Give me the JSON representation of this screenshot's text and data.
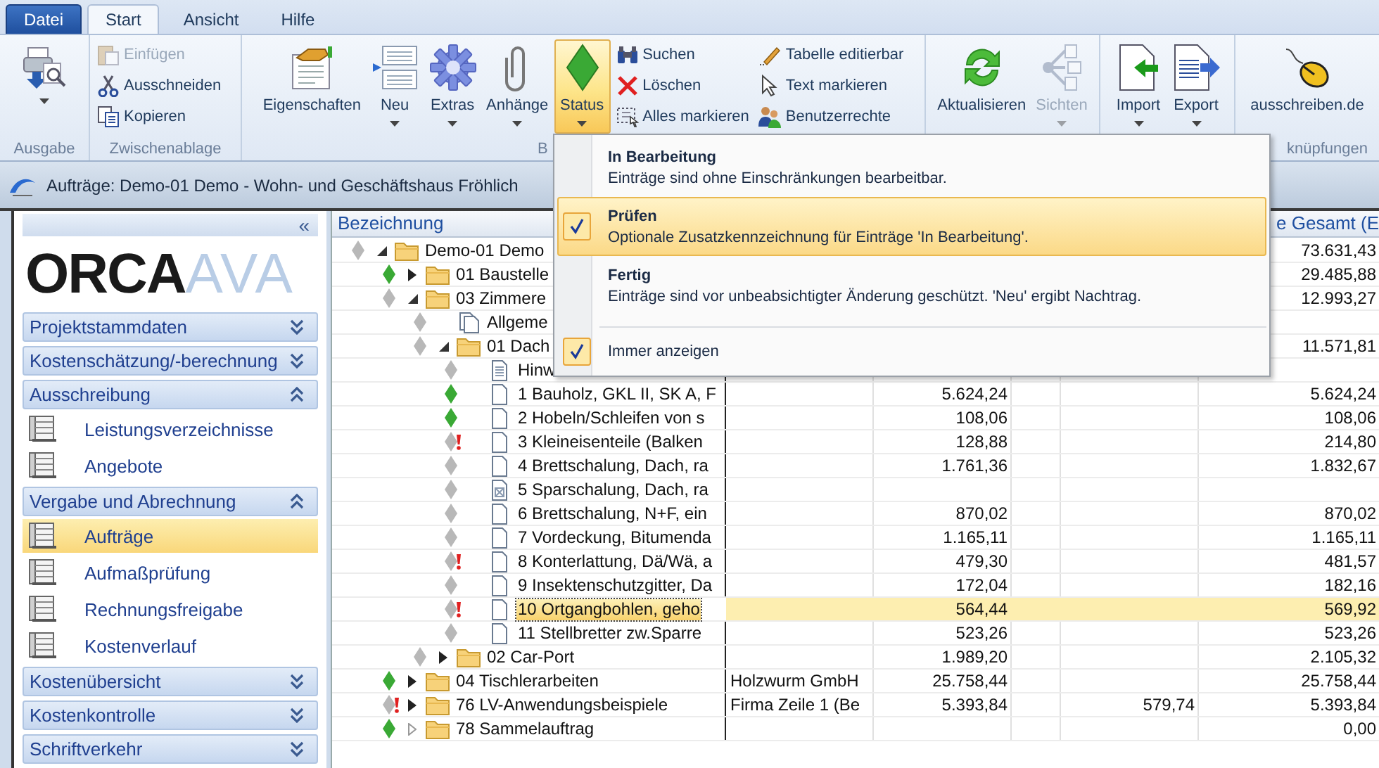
{
  "menu_tabs": [
    {
      "label": "Datei",
      "kind": "file",
      "selected": false
    },
    {
      "label": "Start",
      "kind": "tab",
      "selected": true
    },
    {
      "label": "Ansicht",
      "kind": "tab",
      "selected": false
    },
    {
      "label": "Hilfe",
      "kind": "tab",
      "selected": false
    }
  ],
  "ribbon_groups": [
    {
      "label": "Ausgabe",
      "items": [
        {
          "kind": "large",
          "has_menu": true,
          "disabled": false,
          "pressed": false
        }
      ]
    },
    {
      "label": "Zwischenablage",
      "items": [
        {
          "kind": "small",
          "label": "Einfügen",
          "disabled": true
        },
        {
          "kind": "small",
          "label": "Ausschneiden",
          "disabled": false
        },
        {
          "kind": "small",
          "label": "Kopieren",
          "disabled": false
        }
      ]
    },
    {
      "label": "B",
      "items": [
        {
          "kind": "large",
          "label": "Eigenschaften",
          "has_menu": false,
          "disabled": false,
          "pressed": false
        },
        {
          "kind": "large",
          "label": "Neu",
          "has_menu": true,
          "disabled": false,
          "pressed": false
        },
        {
          "kind": "large",
          "label": "Extras",
          "has_menu": true,
          "disabled": false,
          "pressed": false
        },
        {
          "kind": "large",
          "label": "Anhänge",
          "has_menu": true,
          "disabled": false,
          "pressed": false
        },
        {
          "kind": "large",
          "label": "Status",
          "has_menu": true,
          "disabled": false,
          "pressed": true
        },
        {
          "kind": "small",
          "label": "Suchen",
          "disabled": false
        },
        {
          "kind": "small",
          "label": "Löschen",
          "disabled": false
        },
        {
          "kind": "small",
          "label": "Alles markieren",
          "disabled": false
        },
        {
          "kind": "small",
          "label": "Tabelle editierbar",
          "disabled": false
        },
        {
          "kind": "small",
          "label": "Text markieren",
          "disabled": false
        },
        {
          "kind": "small",
          "label": "Benutzerrechte",
          "disabled": false
        }
      ]
    },
    {
      "items": [
        {
          "kind": "large",
          "label": "Aktualisieren",
          "has_menu": false,
          "disabled": false,
          "pressed": false
        },
        {
          "kind": "large",
          "label": "Sichten",
          "has_menu": true,
          "disabled": true,
          "pressed": false
        }
      ]
    },
    {
      "items": [
        {
          "kind": "large",
          "label": "Import",
          "has_menu": true,
          "disabled": false,
          "pressed": false
        },
        {
          "kind": "large",
          "label": "Export",
          "has_menu": true,
          "disabled": false,
          "pressed": false
        }
      ]
    },
    {
      "label": "knüpfungen",
      "items": [
        {
          "kind": "large",
          "label": "ausschreiben.de",
          "has_menu": false,
          "disabled": false,
          "pressed": false
        }
      ]
    }
  ],
  "document": {
    "title": "Aufträge: Demo-01 Demo - Wohn- und Geschäftshaus Fröhlich"
  },
  "sidebar": {
    "collapse_glyph": "«",
    "logo": {
      "part_1": "ORCA",
      "part_2": "AVA"
    },
    "sections": [
      {
        "label": "Projektstammdaten",
        "expanded": false
      },
      {
        "label": "Kostenschätzung/-berechnung",
        "expanded": false
      },
      {
        "label": "Ausschreibung",
        "expanded": true,
        "items": [
          {
            "label": "Leistungsverzeichnisse",
            "selected": false
          },
          {
            "label": "Angebote",
            "selected": false
          }
        ]
      },
      {
        "label": "Vergabe und Abrechnung",
        "expanded": true,
        "items": [
          {
            "label": "Aufträge",
            "selected": true
          },
          {
            "label": "Aufmaßprüfung",
            "selected": false
          },
          {
            "label": "Rechnungsfreigabe",
            "selected": false
          },
          {
            "label": "Kostenverlauf",
            "selected": false
          }
        ]
      },
      {
        "label": "Kostenübersicht",
        "expanded": false
      },
      {
        "label": "Kostenkontrolle",
        "expanded": false
      },
      {
        "label": "Schriftverkehr",
        "expanded": false
      }
    ]
  },
  "grid": {
    "header": {
      "column_1": "Bezeichnung",
      "column_6": "e Gesamt (E"
    },
    "rows": [
      {
        "label": "Demo-01 Demo",
        "kind": "folder",
        "expanded": true,
        "has_children": true,
        "color": "#b8b8b8",
        "warning": false,
        "selected": false,
        "cells": {
          "column_6": "73.631,43"
        },
        "children": [
          {
            "label": "01 Baustelle",
            "kind": "folder",
            "expanded": false,
            "has_children": true,
            "color": "#3aa935",
            "warning": false,
            "selected": false,
            "cells": {
              "column_6": "29.485,88"
            }
          },
          {
            "label": "03 Zimmere",
            "kind": "folder",
            "expanded": true,
            "has_children": true,
            "color": "#b8b8b8",
            "warning": false,
            "selected": false,
            "cells": {
              "column_6": "12.993,27"
            },
            "children": [
              {
                "label": "Allgeme",
                "kind": "multi-doc",
                "color": "#b8b8b8",
                "warning": false,
                "selected": false
              },
              {
                "label": "01 Dach",
                "kind": "folder",
                "expanded": true,
                "has_children": true,
                "color": "#b8b8b8",
                "warning": false,
                "selected": false,
                "cells": {
                  "column_6": "11.571,81"
                },
                "children": [
                  {
                    "label": "Hinw",
                    "kind": "text-doc",
                    "color": "#b8b8b8",
                    "warning": false,
                    "selected": false
                  },
                  {
                    "label": "1 Bauholz, GKL II, SK A, F",
                    "kind": "doc",
                    "color": "#3aa935",
                    "warning": false,
                    "selected": false,
                    "cells": {
                      "column_3": "5.624,24",
                      "column_6": "5.624,24"
                    }
                  },
                  {
                    "label": "2 Hobeln/Schleifen von s",
                    "kind": "doc",
                    "color": "#3aa935",
                    "warning": false,
                    "selected": false,
                    "cells": {
                      "column_3": "108,06",
                      "column_6": "108,06"
                    }
                  },
                  {
                    "label": "3 Kleineisenteile (Balken",
                    "kind": "doc",
                    "color": "#b8b8b8",
                    "warning": true,
                    "selected": false,
                    "cells": {
                      "column_3": "128,88",
                      "column_6": "214,80"
                    }
                  },
                  {
                    "label": "4 Brettschalung, Dach, ra",
                    "kind": "doc",
                    "color": "#b8b8b8",
                    "warning": false,
                    "selected": false,
                    "cells": {
                      "column_3": "1.761,36",
                      "column_6": "1.832,67"
                    }
                  },
                  {
                    "label": "5 Sparschalung, Dach, ra",
                    "kind": "void-doc",
                    "color": "#b8b8b8",
                    "warning": false,
                    "selected": false
                  },
                  {
                    "label": "6 Brettschalung, N+F, ein",
                    "kind": "doc",
                    "color": "#b8b8b8",
                    "warning": false,
                    "selected": false,
                    "cells": {
                      "column_3": "870,02",
                      "column_6": "870,02"
                    }
                  },
                  {
                    "label": "7 Vordeckung, Bitumenda",
                    "kind": "doc",
                    "color": "#b8b8b8",
                    "warning": false,
                    "selected": false,
                    "cells": {
                      "column_3": "1.165,11",
                      "column_6": "1.165,11"
                    }
                  },
                  {
                    "label": "8 Konterlattung, Dä/Wä, a",
                    "kind": "doc",
                    "color": "#b8b8b8",
                    "warning": true,
                    "selected": false,
                    "cells": {
                      "column_3": "479,30",
                      "column_6": "481,57"
                    }
                  },
                  {
                    "label": "9 Insektenschutzgitter, Da",
                    "kind": "doc",
                    "color": "#b8b8b8",
                    "warning": false,
                    "selected": false,
                    "cells": {
                      "column_3": "172,04",
                      "column_6": "182,16"
                    }
                  },
                  {
                    "label": "10 Ortgangbohlen, geho",
                    "kind": "doc",
                    "color": "#b8b8b8",
                    "warning": true,
                    "selected": true,
                    "cells": {
                      "column_3": "564,44",
                      "column_6": "569,92"
                    }
                  },
                  {
                    "label": "11 Stellbretter zw.Sparre",
                    "kind": "doc",
                    "color": "#b8b8b8",
                    "warning": false,
                    "selected": false,
                    "cells": {
                      "column_3": "523,26",
                      "column_6": "523,26"
                    }
                  }
                ]
              },
              {
                "label": "02 Car-Port",
                "kind": "folder",
                "expanded": false,
                "has_children": true,
                "color": "#b8b8b8",
                "warning": false,
                "selected": false,
                "cells": {
                  "column_3": "1.989,20",
                  "column_6": "2.105,32"
                }
              }
            ]
          },
          {
            "label": "04 Tischlerarbeiten",
            "kind": "folder",
            "expanded": false,
            "has_children": true,
            "color": "#3aa935",
            "warning": false,
            "selected": false,
            "cells": {
              "column_2": "Holzwurm GmbH",
              "column_3": "25.758,44",
              "column_6": "25.758,44"
            }
          },
          {
            "label": "76 LV-Anwendungsbeispiele",
            "kind": "folder",
            "expanded": false,
            "has_children": true,
            "color": "#b8b8b8",
            "warning": true,
            "selected": false,
            "cells": {
              "column_2": "Firma Zeile 1 (Be",
              "column_3": "5.393,84",
              "column_5": "579,74",
              "column_6": "5.393,84"
            }
          },
          {
            "label": "78 Sammelauftrag",
            "kind": "folder",
            "expanded": false,
            "has_children": false,
            "color": "#3aa935",
            "warning": false,
            "selected": false,
            "cells": {
              "column_6": "0,00"
            }
          }
        ]
      }
    ]
  },
  "status_menu": {
    "options": [
      {
        "title": "In Bearbeitung",
        "description": "Einträge sind ohne Einschränkungen bearbeitbar.",
        "checked": false,
        "selected": false
      },
      {
        "title": "Prüfen",
        "description": "Optionale Zusatzkennzeichnung für Einträge 'In Bearbeitung'.",
        "checked": true,
        "selected": true
      },
      {
        "title": "Fertig",
        "description": "Einträge sind vor unbeabsichtigter Änderung geschützt. 'Neu' ergibt Nachtrag.",
        "checked": false,
        "selected": false
      }
    ],
    "always_show": {
      "label": "Immer anzeigen",
      "checked": true
    }
  }
}
